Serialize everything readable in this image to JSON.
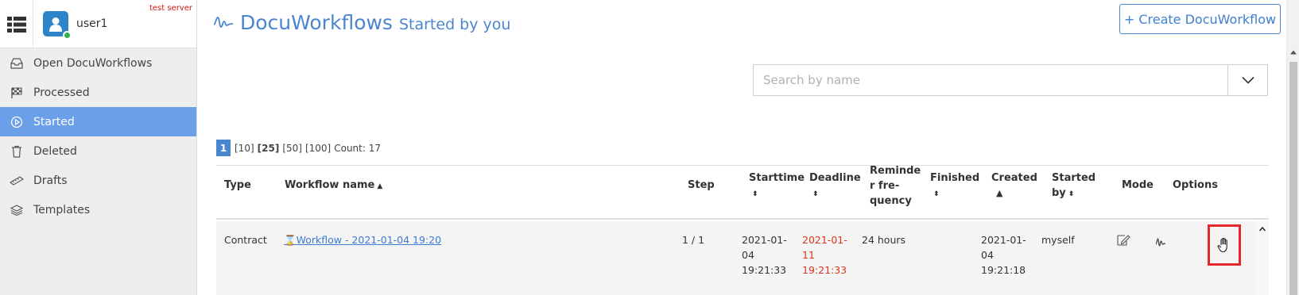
{
  "sidebar": {
    "menu_icon": "grid-menu-icon",
    "username": "user1",
    "server_label": "test server",
    "items": [
      {
        "label": "Open DocuWorkflows",
        "icon": "inbox-icon"
      },
      {
        "label": "Processed",
        "icon": "checkered-flag-icon"
      },
      {
        "label": "Started",
        "icon": "play-circle-icon"
      },
      {
        "label": "Deleted",
        "icon": "trash-icon"
      },
      {
        "label": "Drafts",
        "icon": "ruler-icon"
      },
      {
        "label": "Templates",
        "icon": "layers-icon"
      }
    ],
    "active_item": "Started"
  },
  "header": {
    "title": "DocuWorkflows",
    "subtitle": "Started by you",
    "create_button": "+ Create DocuWorkflow"
  },
  "search": {
    "placeholder": "Search by name"
  },
  "pager": {
    "current_page": "1",
    "sizes": [
      "[10]",
      "[25]",
      "[50]",
      "[100]"
    ],
    "selected_size": "[25]",
    "count": "Count: 17"
  },
  "table": {
    "headers": {
      "type": "Type",
      "workflow_name": "Workflow name",
      "step": "Step",
      "starttime": "Starttime",
      "deadline": "Deadline",
      "reminder_1": "Reminde",
      "reminder_2": "r fre-",
      "reminder_3": "quency",
      "finished": "Finished",
      "created": "Created",
      "started_by_1": "Started",
      "started_by_2": "by",
      "mode": "Mode",
      "options": "Options"
    },
    "rows": [
      {
        "type": "Contract",
        "workflow_name": "Workflow - 2021-01-04 19:20",
        "step": "1 / 1",
        "starttime": [
          "2021-01-",
          "04",
          "19:21:33"
        ],
        "deadline": [
          "2021-01-",
          "11",
          "19:21:33"
        ],
        "reminder_frequency": "24 hours",
        "finished": "",
        "created": [
          "2021-01-",
          "04",
          "19:21:18"
        ],
        "started_by": "myself"
      }
    ]
  },
  "colors": {
    "accent": "#4a86cf",
    "active_nav": "#6b9fe8",
    "deadline_red": "#d8371a",
    "highlight_box": "#e5262b"
  }
}
